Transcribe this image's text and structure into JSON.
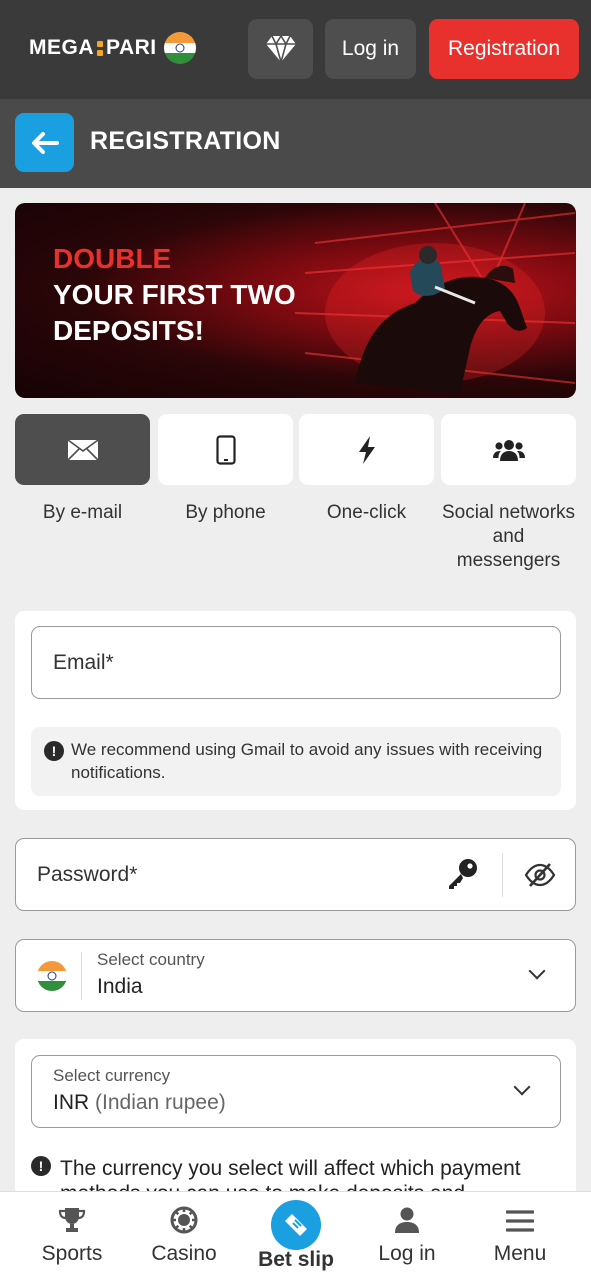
{
  "header": {
    "logo_left": "MEGA",
    "logo_right": "PARI",
    "login_label": "Log in",
    "register_label": "Registration"
  },
  "page": {
    "title": "REGISTRATION"
  },
  "banner": {
    "line1": "DOUBLE",
    "line2": "YOUR FIRST TWO",
    "line3": "DEPOSITS!"
  },
  "methods": [
    {
      "label": "By e-mail",
      "icon": "envelope-icon",
      "active": true
    },
    {
      "label": "By phone",
      "icon": "phone-icon",
      "active": false
    },
    {
      "label": "One-click",
      "icon": "lightning-icon",
      "active": false
    },
    {
      "label": "Social networks and messengers",
      "icon": "people-icon",
      "active": false
    }
  ],
  "form": {
    "email_placeholder": "Email*",
    "email_notice": "We recommend using Gmail to avoid any issues with receiving notifications.",
    "password_placeholder": "Password*",
    "country_label": "Select country",
    "country_value": "India",
    "currency_label": "Select currency",
    "currency_code": "INR",
    "currency_name": "(Indian rupee)",
    "currency_notice": "The currency you select will affect which payment methods you can use to make deposits and"
  },
  "bottom_nav": {
    "sports": "Sports",
    "casino": "Casino",
    "betslip": "Bet slip",
    "login": "Log in",
    "menu": "Menu"
  },
  "colors": {
    "accent_red": "#e8312d",
    "accent_blue": "#1a9fe0",
    "header_bg": "#3a3a3a"
  }
}
